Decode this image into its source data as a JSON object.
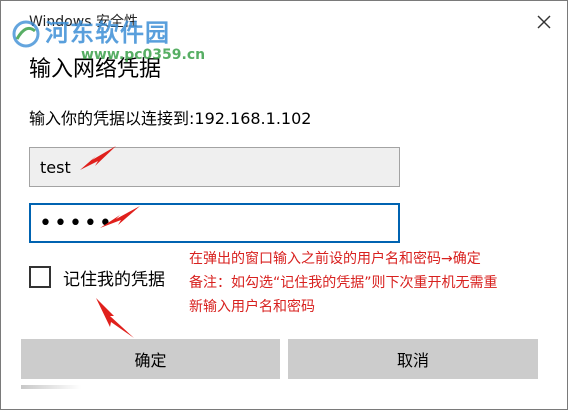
{
  "window": {
    "title": "Windows 安全性"
  },
  "watermark": {
    "name": "河东软件园",
    "url": "www.pc0359.cn"
  },
  "dialog": {
    "heading": "输入网络凭据",
    "subtext": "输入你的凭据以连接到:192.168.1.102"
  },
  "form": {
    "username_value": "test",
    "password_value": "•••••",
    "remember_label": "记住我的凭据",
    "remember_checked": false
  },
  "annotation": {
    "line1": "在弹出的窗口输入之前设的用户名和密码→确定",
    "line2": "备注：如勾选“记住我的凭据”则下次重开机无需重",
    "line3": "新输入用户名和密码",
    "color": "#d8211f"
  },
  "buttons": {
    "ok_label": "确定",
    "cancel_label": "取消"
  },
  "colors": {
    "focus_border": "#0063b1",
    "button_bg": "#cccccc",
    "arrow": "#e0201c"
  },
  "icons": {
    "close": "close-icon",
    "watermark_logo": "logo-icon"
  }
}
